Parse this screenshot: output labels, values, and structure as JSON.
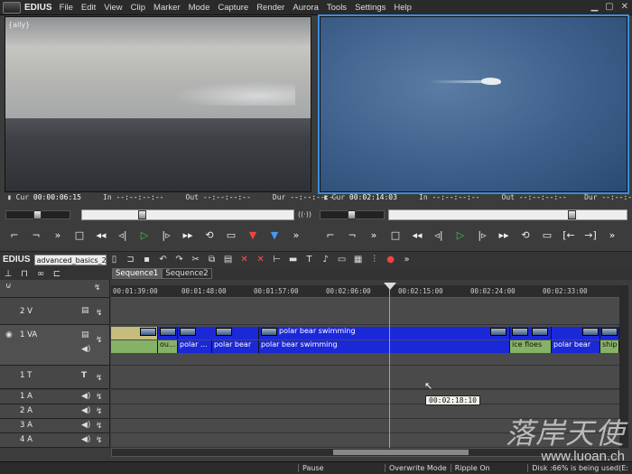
{
  "app": {
    "name": "EDIUS"
  },
  "menu": [
    "File",
    "Edit",
    "View",
    "Clip",
    "Marker",
    "Mode",
    "Capture",
    "Render",
    "Aurora",
    "Tools",
    "Settings",
    "Help"
  ],
  "player": {
    "label": "Cur",
    "cur": "00:00:06:15",
    "in_label": "In",
    "in": "--:--:--:--",
    "out_label": "Out",
    "out": "--:--:--:--",
    "dur_label": "Dur",
    "dur": "--:--:--:--",
    "tag": "{ally}"
  },
  "recorder": {
    "label": "Cur",
    "cur": "00:02:14:03",
    "in_label": "In",
    "in": "--:--:--:--",
    "out_label": "Out",
    "out": "--:--:--:--",
    "dur_label": "Dur",
    "dur": "--:--:--:--"
  },
  "timeline": {
    "name": "EDIUS",
    "project": "advanced_basics_2",
    "tabs": [
      "Sequence1",
      "Sequence2"
    ],
    "ruler": [
      "00:01:39:00",
      "00:01:48:00",
      "00:01:57:00",
      "00:02:06:00",
      "00:02:15:00",
      "00:02:24:00",
      "00:02:33:00"
    ],
    "tracks": [
      "2 V",
      "1 VA",
      "1 T",
      "1 A",
      "2 A",
      "3 A",
      "4 A"
    ],
    "clips": {
      "v": [
        "polar bear swimming"
      ],
      "a": [
        "ou...",
        "polar ...",
        "polar bear",
        "polar bear swimming",
        "ice floes",
        "polar bear",
        "ship"
      ]
    },
    "tooltip": "00:02:18:10"
  },
  "status": {
    "pause": "Pause",
    "mode": "Overwrite Mode",
    "ripple": "Ripple On",
    "disk": "Disk :66% is being used(E:"
  },
  "watermark": {
    "logo": "落岸天使",
    "url": "www.luoan.ch"
  }
}
